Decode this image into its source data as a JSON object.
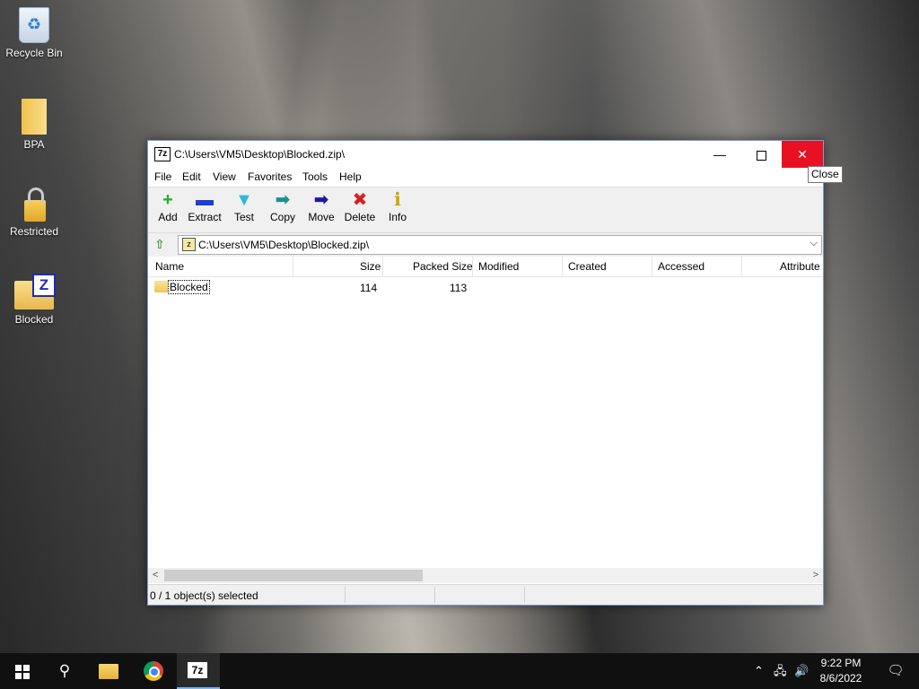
{
  "desktop": {
    "icons": [
      {
        "label": "Recycle Bin"
      },
      {
        "label": "BPA"
      },
      {
        "label": "Restricted"
      },
      {
        "label": "Blocked",
        "badge": "Z"
      }
    ]
  },
  "window": {
    "app_icon": "7z",
    "title": "C:\\Users\\VM5\\Desktop\\Blocked.zip\\",
    "controls": {
      "minimize": "—",
      "close": "✕"
    },
    "menu": [
      "File",
      "Edit",
      "View",
      "Favorites",
      "Tools",
      "Help"
    ],
    "toolbar": [
      {
        "label": "Add",
        "icon": "plus-icon",
        "glyph": "+",
        "color": "#22b022"
      },
      {
        "label": "Extract",
        "icon": "minus-icon",
        "glyph": "▬",
        "color": "#1d3fd0"
      },
      {
        "label": "Test",
        "icon": "check-down-icon",
        "glyph": "▼",
        "color": "#2bbbd4"
      },
      {
        "label": "Copy",
        "icon": "double-arrow-icon",
        "glyph": "➡",
        "color": "#1f8f8f"
      },
      {
        "label": "Move",
        "icon": "arrow-right-icon",
        "glyph": "➡",
        "color": "#1a1aa8"
      },
      {
        "label": "Delete",
        "icon": "x-icon",
        "glyph": "✖",
        "color": "#d81e1e"
      },
      {
        "label": "Info",
        "icon": "info-icon",
        "glyph": "ℹ",
        "color": "#c8a500"
      }
    ],
    "address": {
      "up_glyph": "⇧",
      "path": "C:\\Users\\VM5\\Desktop\\Blocked.zip\\",
      "dropdown": "⌵"
    },
    "columns": [
      "Name",
      "Size",
      "Packed Size",
      "Modified",
      "Created",
      "Accessed",
      "Attribute"
    ],
    "rows": [
      {
        "name": "Blocked",
        "size": "114",
        "packed_size": "113",
        "modified": "",
        "created": "",
        "accessed": "",
        "attributes": ""
      }
    ],
    "scroll": {
      "left": "<",
      "right": ">"
    },
    "status": "0 / 1 object(s) selected"
  },
  "tooltip": "Close",
  "taskbar": {
    "search_glyph": "⚲",
    "tray_chevron": "⌃",
    "tray_network": "🖧",
    "tray_volume": "🔊",
    "time": "9:22 PM",
    "date": "8/6/2022",
    "notification_glyph": "🗨"
  }
}
